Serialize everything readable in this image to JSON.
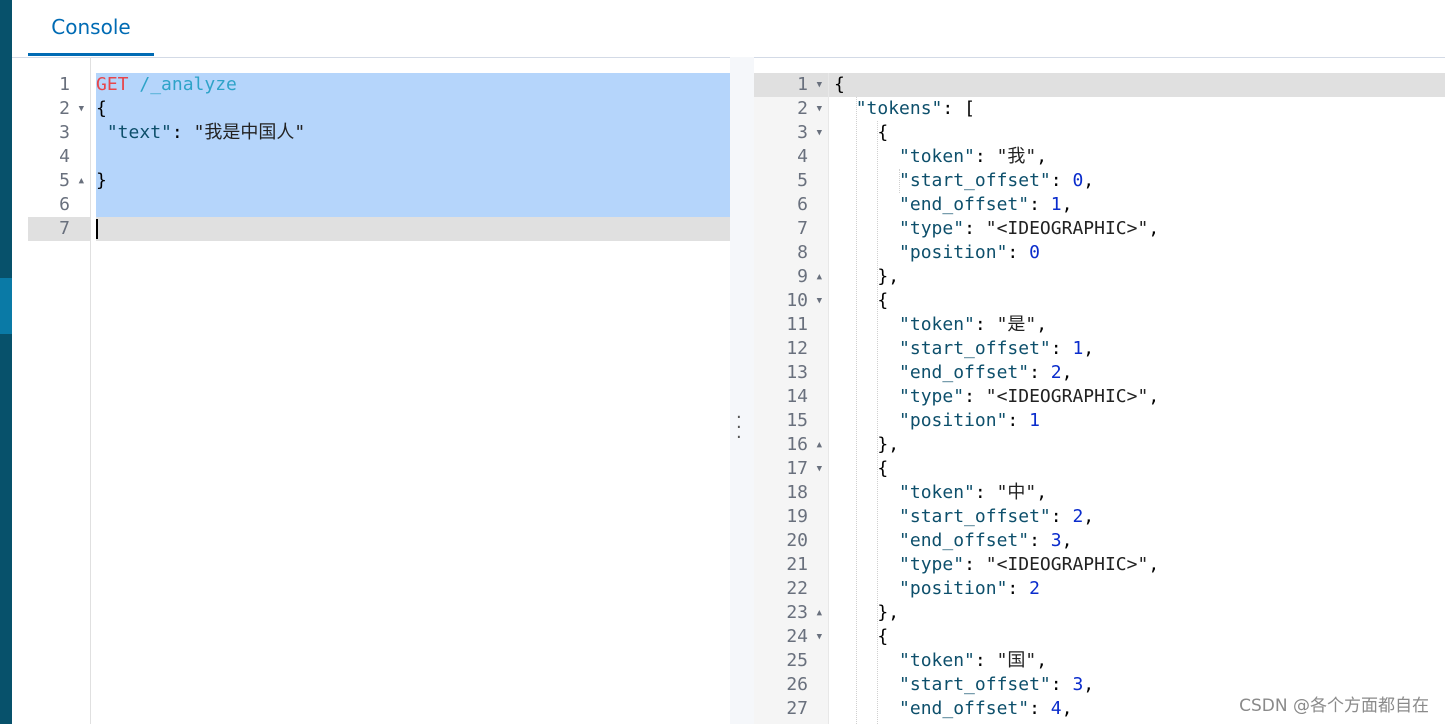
{
  "tab": {
    "label": "Console"
  },
  "request": {
    "lines": [
      {
        "num": "1",
        "fold": "",
        "method": "GET",
        "path": "/_analyze"
      },
      {
        "num": "2",
        "fold": "▼",
        "text": "{"
      },
      {
        "num": "3",
        "fold": "",
        "key": "\"text\"",
        "sep": ": ",
        "value": "\"我是中国人\""
      },
      {
        "num": "4",
        "fold": "",
        "text": ""
      },
      {
        "num": "5",
        "fold": "▲",
        "text": "}"
      },
      {
        "num": "6",
        "fold": "",
        "text": ""
      },
      {
        "num": "7",
        "fold": "",
        "text": ""
      }
    ]
  },
  "response": {
    "lines": [
      {
        "num": "1",
        "fold": "▼",
        "indent": 0,
        "text": "{"
      },
      {
        "num": "2",
        "fold": "▼",
        "indent": 1,
        "key": "\"tokens\"",
        "rest": ": ["
      },
      {
        "num": "3",
        "fold": "▼",
        "indent": 2,
        "text": "{"
      },
      {
        "num": "4",
        "fold": "",
        "indent": 3,
        "key": "\"token\"",
        "sep": ": ",
        "str": "\"我\"",
        "end": ","
      },
      {
        "num": "5",
        "fold": "",
        "indent": 3,
        "key": "\"start_offset\"",
        "sep": ": ",
        "numv": "0",
        "end": ","
      },
      {
        "num": "6",
        "fold": "",
        "indent": 3,
        "key": "\"end_offset\"",
        "sep": ": ",
        "numv": "1",
        "end": ","
      },
      {
        "num": "7",
        "fold": "",
        "indent": 3,
        "key": "\"type\"",
        "sep": ": ",
        "str": "\"<IDEOGRAPHIC>\"",
        "end": ","
      },
      {
        "num": "8",
        "fold": "",
        "indent": 3,
        "key": "\"position\"",
        "sep": ": ",
        "numv": "0",
        "end": ""
      },
      {
        "num": "9",
        "fold": "▲",
        "indent": 2,
        "text": "},"
      },
      {
        "num": "10",
        "fold": "▼",
        "indent": 2,
        "text": "{"
      },
      {
        "num": "11",
        "fold": "",
        "indent": 3,
        "key": "\"token\"",
        "sep": ": ",
        "str": "\"是\"",
        "end": ","
      },
      {
        "num": "12",
        "fold": "",
        "indent": 3,
        "key": "\"start_offset\"",
        "sep": ": ",
        "numv": "1",
        "end": ","
      },
      {
        "num": "13",
        "fold": "",
        "indent": 3,
        "key": "\"end_offset\"",
        "sep": ": ",
        "numv": "2",
        "end": ","
      },
      {
        "num": "14",
        "fold": "",
        "indent": 3,
        "key": "\"type\"",
        "sep": ": ",
        "str": "\"<IDEOGRAPHIC>\"",
        "end": ","
      },
      {
        "num": "15",
        "fold": "",
        "indent": 3,
        "key": "\"position\"",
        "sep": ": ",
        "numv": "1",
        "end": ""
      },
      {
        "num": "16",
        "fold": "▲",
        "indent": 2,
        "text": "},"
      },
      {
        "num": "17",
        "fold": "▼",
        "indent": 2,
        "text": "{"
      },
      {
        "num": "18",
        "fold": "",
        "indent": 3,
        "key": "\"token\"",
        "sep": ": ",
        "str": "\"中\"",
        "end": ","
      },
      {
        "num": "19",
        "fold": "",
        "indent": 3,
        "key": "\"start_offset\"",
        "sep": ": ",
        "numv": "2",
        "end": ","
      },
      {
        "num": "20",
        "fold": "",
        "indent": 3,
        "key": "\"end_offset\"",
        "sep": ": ",
        "numv": "3",
        "end": ","
      },
      {
        "num": "21",
        "fold": "",
        "indent": 3,
        "key": "\"type\"",
        "sep": ": ",
        "str": "\"<IDEOGRAPHIC>\"",
        "end": ","
      },
      {
        "num": "22",
        "fold": "",
        "indent": 3,
        "key": "\"position\"",
        "sep": ": ",
        "numv": "2",
        "end": ""
      },
      {
        "num": "23",
        "fold": "▲",
        "indent": 2,
        "text": "},"
      },
      {
        "num": "24",
        "fold": "▼",
        "indent": 2,
        "text": "{"
      },
      {
        "num": "25",
        "fold": "",
        "indent": 3,
        "key": "\"token\"",
        "sep": ": ",
        "str": "\"国\"",
        "end": ","
      },
      {
        "num": "26",
        "fold": "",
        "indent": 3,
        "key": "\"start_offset\"",
        "sep": ": ",
        "numv": "3",
        "end": ","
      },
      {
        "num": "27",
        "fold": "",
        "indent": 3,
        "key": "\"end_offset\"",
        "sep": ": ",
        "numv": "4",
        "end": ","
      }
    ]
  },
  "watermark": "CSDN @各个方面都自在"
}
